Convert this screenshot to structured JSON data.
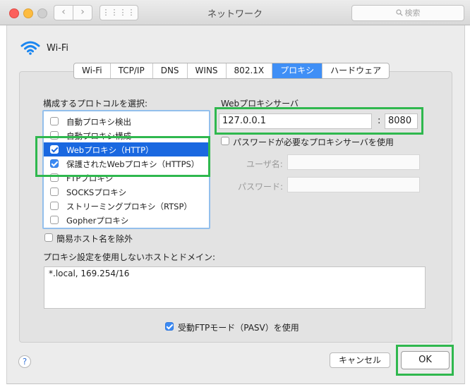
{
  "window": {
    "title": "ネットワーク",
    "search_placeholder": "検索",
    "nav_back": "‹",
    "nav_forward": "›",
    "grid_glyph": "⋮⋮⋮⋮"
  },
  "interface": {
    "name": "Wi-Fi",
    "icon": "wifi-icon"
  },
  "tabs": [
    {
      "label": "Wi-Fi",
      "active": false
    },
    {
      "label": "TCP/IP",
      "active": false
    },
    {
      "label": "DNS",
      "active": false
    },
    {
      "label": "WINS",
      "active": false
    },
    {
      "label": "802.1X",
      "active": false
    },
    {
      "label": "プロキシ",
      "active": true
    },
    {
      "label": "ハードウェア",
      "active": false
    }
  ],
  "protocols": {
    "heading": "構成するプロトコルを選択:",
    "items": [
      {
        "label": "自動プロキシ検出",
        "checked": false,
        "selected": false
      },
      {
        "label": "自動プロキシ構成",
        "checked": false,
        "selected": false
      },
      {
        "label": "Webプロキシ（HTTP）",
        "checked": true,
        "selected": true
      },
      {
        "label": "保護されたWebプロキシ（HTTPS）",
        "checked": true,
        "selected": false
      },
      {
        "label": "FTPプロキシ",
        "checked": false,
        "selected": false
      },
      {
        "label": "SOCKSプロキシ",
        "checked": false,
        "selected": false
      },
      {
        "label": "ストリーミングプロキシ（RTSP）",
        "checked": false,
        "selected": false
      },
      {
        "label": "Gopherプロキシ",
        "checked": false,
        "selected": false
      }
    ]
  },
  "proxy_server": {
    "heading": "Webプロキシサーバ",
    "host": "127.0.0.1",
    "separator": ":",
    "port": "8080",
    "password_required_label": "パスワードが必要なプロキシサーバを使用",
    "password_required": false,
    "username_label": "ユーザ名:",
    "password_label": "パスワード:"
  },
  "exclude_simple_hostnames": {
    "label": "簡易ホスト名を除外",
    "checked": false
  },
  "bypass": {
    "heading": "プロキシ設定を使用しないホストとドメイン:",
    "value": "*.local, 169.254/16"
  },
  "passive_ftp": {
    "label": "受動FTPモード（PASV）を使用",
    "checked": true
  },
  "buttons": {
    "help": "?",
    "cancel": "キャンセル",
    "ok": "OK"
  },
  "colors": {
    "accent": "#3f8ff6",
    "selection": "#1a68e0",
    "highlight_box": "#2fb84e"
  }
}
